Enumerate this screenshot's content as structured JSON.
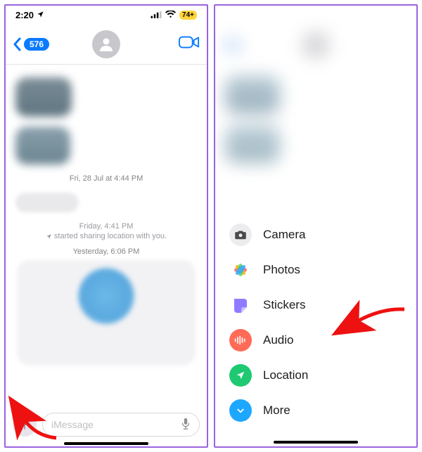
{
  "status": {
    "time": "2:20",
    "battery": "74+"
  },
  "nav": {
    "back_count": "576"
  },
  "chat": {
    "ts1": "Fri, 28 Jul at 4:44 PM",
    "ts2_a": "Friday, 4:41 PM",
    "ts2_b": "started sharing location with you.",
    "ts3": "Yesterday, 6:06 PM"
  },
  "composer": {
    "placeholder": "iMessage"
  },
  "sheet": {
    "items": [
      {
        "label": "Camera"
      },
      {
        "label": "Photos"
      },
      {
        "label": "Stickers"
      },
      {
        "label": "Audio"
      },
      {
        "label": "Location"
      },
      {
        "label": "More"
      }
    ]
  }
}
